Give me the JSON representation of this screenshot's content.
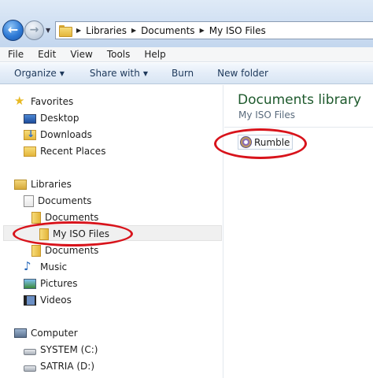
{
  "address": {
    "crumbs": [
      "Libraries",
      "Documents",
      "My ISO Files"
    ]
  },
  "menu": [
    "File",
    "Edit",
    "View",
    "Tools",
    "Help"
  ],
  "commands": {
    "organize": "Organize",
    "share": "Share with",
    "burn": "Burn",
    "new_folder": "New folder"
  },
  "nav": {
    "favorites": "Favorites",
    "desktop": "Desktop",
    "downloads": "Downloads",
    "recent": "Recent Places",
    "libraries": "Libraries",
    "documents": "Documents",
    "documents_sub1": "Documents",
    "my_iso": "My ISO Files",
    "documents_sub2": "Documents",
    "music": "Music",
    "pictures": "Pictures",
    "videos": "Videos",
    "computer": "Computer",
    "system_drive": "SYSTEM (C:)",
    "satria_drive": "SATRIA (D:)"
  },
  "content": {
    "title": "Documents library",
    "subtitle": "My ISO Files",
    "files": [
      "Rumble"
    ]
  },
  "colors": {
    "annotation": "#d8131b",
    "library_title": "#1e5a2d",
    "command_text": "#1e395b"
  }
}
